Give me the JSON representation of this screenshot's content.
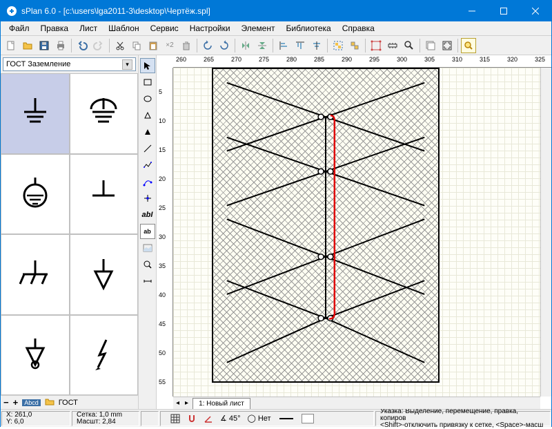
{
  "app": {
    "title": "sPlan 6.0 - [c:\\users\\lga2011-3\\desktop\\Чертёж.spl]"
  },
  "menu": {
    "items": [
      "Файл",
      "Правка",
      "Лист",
      "Шаблон",
      "Сервис",
      "Настройки",
      "Элемент",
      "Библиотека",
      "Справка"
    ]
  },
  "library": {
    "category": "ГОСТ Заземление",
    "footer_label": "ГОСТ",
    "footer_minus": "−",
    "footer_plus": "+"
  },
  "ruler": {
    "h": [
      "260",
      "265",
      "270",
      "275",
      "280",
      "285",
      "290",
      "295",
      "300",
      "305",
      "310",
      "315",
      "320",
      "325"
    ],
    "v": [
      "5",
      "10",
      "15",
      "20",
      "25",
      "30",
      "35",
      "40",
      "45",
      "50",
      "55"
    ]
  },
  "tabs": {
    "current": "1: Новый лист"
  },
  "status": {
    "coord_x": "X: 261,0",
    "coord_y": "Y: 6,0",
    "grid": "Сетка:   1,0 mm",
    "scale": "Масшт:  2,84",
    "angle": "45°",
    "snap": "Нет",
    "hint": "Указка: Выделение, перемещение, правка, копиров",
    "hint2": "<Shift>-отключить привязку к сетке, <Space>-масш"
  },
  "colors": {
    "accent": "#0078d7",
    "red_wire": "#e00000"
  }
}
